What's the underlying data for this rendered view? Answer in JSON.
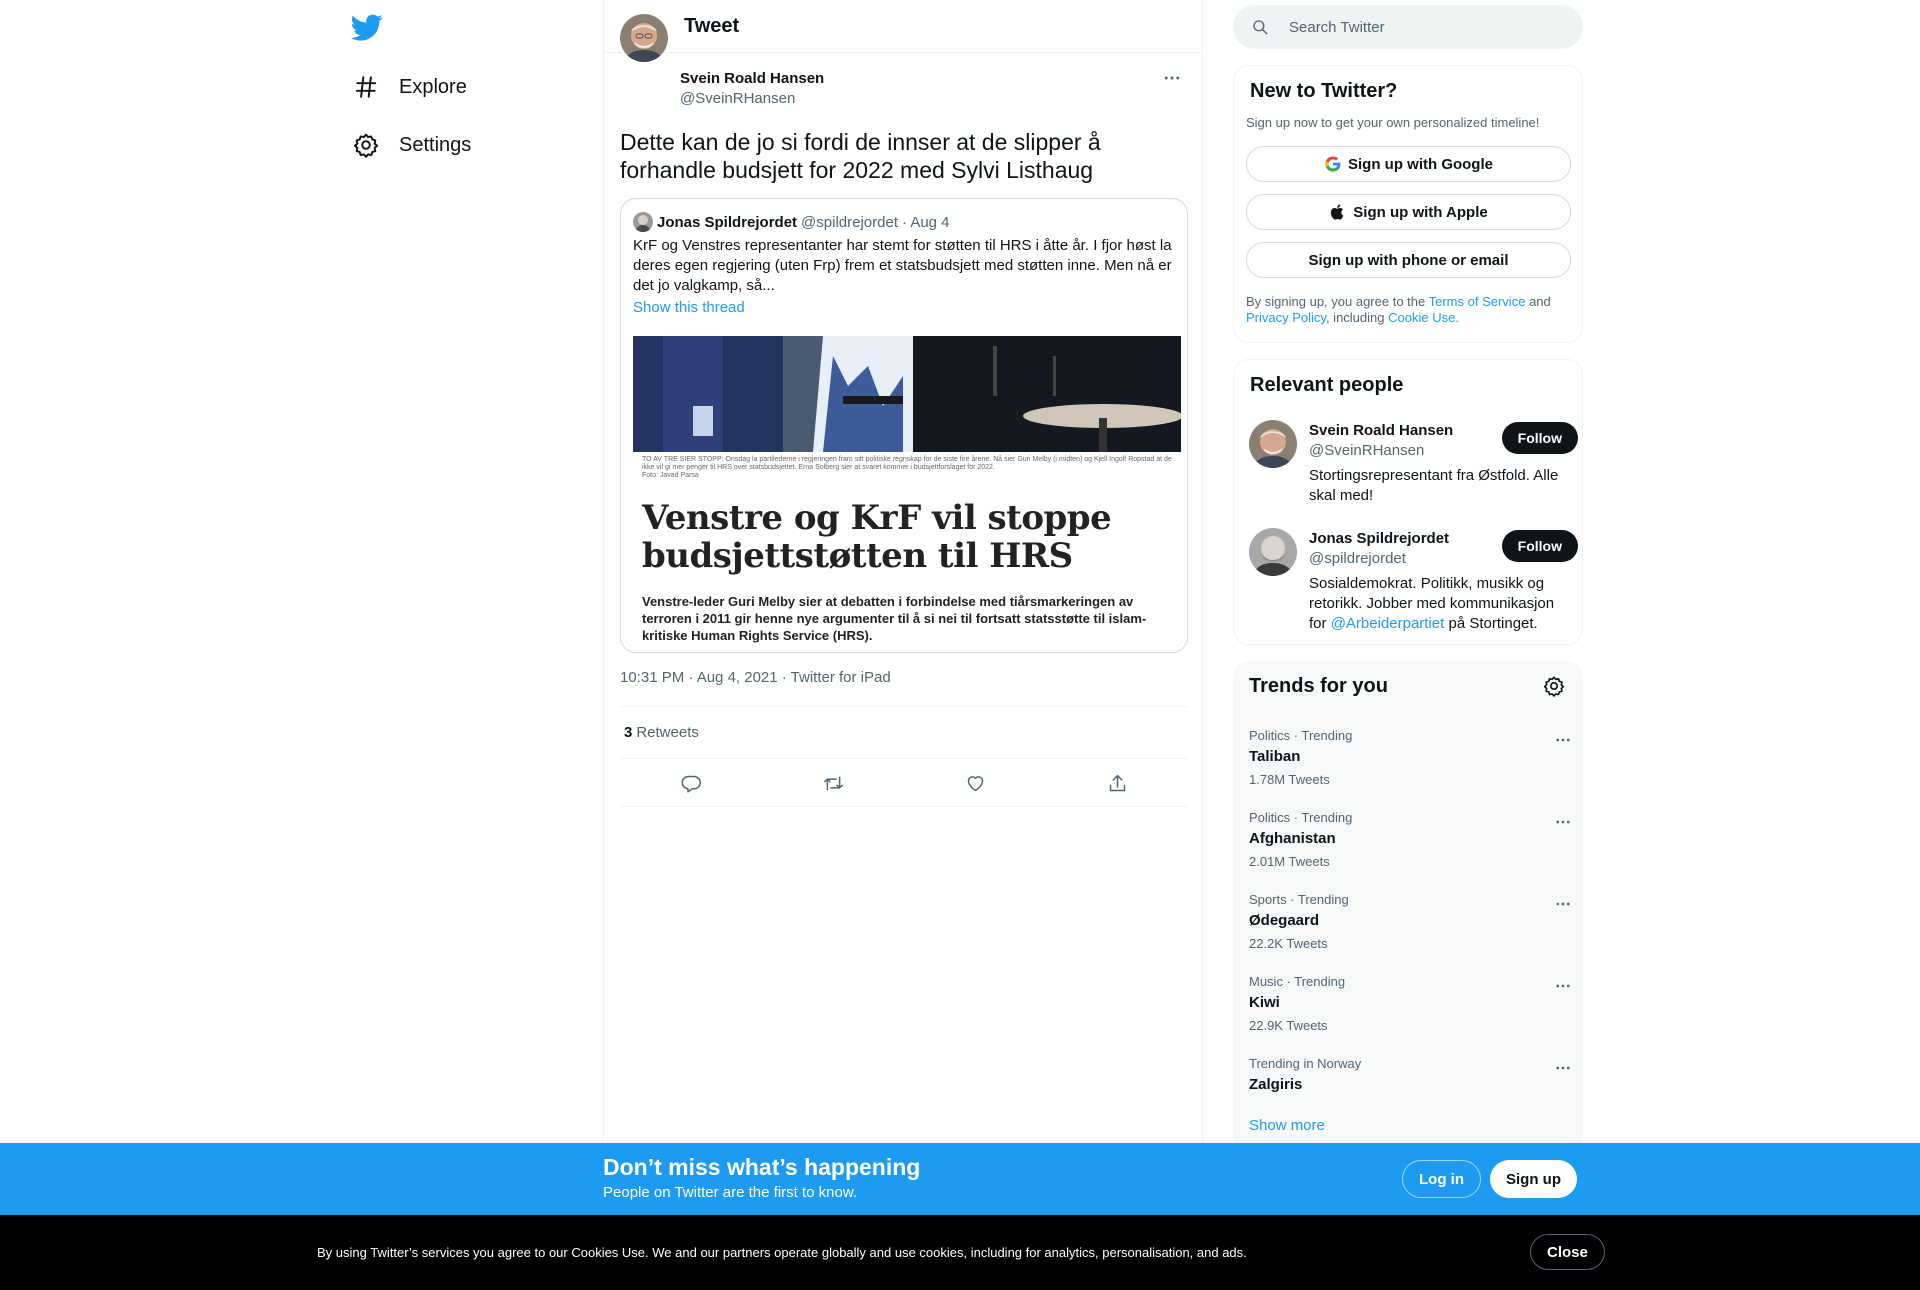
{
  "nav": {
    "items": [
      {
        "label": "Explore",
        "icon": "hashtag-icon"
      },
      {
        "label": "Settings",
        "icon": "gear-icon"
      }
    ]
  },
  "header": {
    "title": "Tweet"
  },
  "tweet": {
    "author_name": "Svein Roald Hansen",
    "author_handle": "@SveinRHansen",
    "text": "Dette kan de jo si fordi de innser at de slipper å forhandle budsjett for 2022 med Sylvi Listhaug",
    "timestamp": "10:31 PM · Aug 4, 2021 · Twitter for iPad",
    "retweets_count": "3",
    "retweets_label": "Retweets",
    "quote": {
      "author_name": "Jonas Spildrejordet",
      "author_handle": "@spildrejordet",
      "date": "· Aug 4",
      "text": "KrF og Venstres representanter har stemt for støtten til HRS i åtte år. I fjor høst la deres egen regjering (uten Frp) frem et statsbudsjett med støtten inne. Men nå er det jo valgkamp, så...",
      "show_thread": "Show this thread",
      "image": {
        "caption": "TO AV TRE SIER STOPP: Onsdag la partilederne i regjeringen fram sitt politiske regnskap for de siste fire årene. Nå sier Guri Melby (i midten) og Kjell Ingolf Ropstad at de ikke vil gi mer penger til HRS over statsbudsjettet. Erna Solberg sier at svaret kommer i budsjettforslaget for 2022.",
        "photo_credit": "Foto: Javad Parsa",
        "headline": "Venstre og KrF vil stoppe budsjettstøtten til HRS",
        "lede": "Venstre-leder Guri Melby sier at debatten i forbindelse med tiårsmarkeringen av terroren i 2011 gir henne nye argumenter til å si nei til fortsatt statsstøtte til islam-kritiske Human Rights Service (HRS)."
      }
    }
  },
  "search": {
    "placeholder": "Search Twitter"
  },
  "signup": {
    "title": "New to Twitter?",
    "subtitle": "Sign up now to get your own personalized timeline!",
    "google": "Sign up with Google",
    "apple": "Sign up with Apple",
    "phone": "Sign up with phone or email",
    "legal_prefix": "By signing up, you agree to the",
    "terms": "Terms of Service",
    "and": "and",
    "privacy": "Privacy Policy",
    "including": ", including",
    "cookie": "Cookie Use."
  },
  "people": {
    "title": "Relevant people",
    "items": [
      {
        "name": "Svein Roald Hansen",
        "handle": "@SveinRHansen",
        "bio": "Stortingsrepresentant fra Østfold. Alle skal med!",
        "follow": "Follow"
      },
      {
        "name": "Jonas Spildrejordet",
        "handle": "@spildrejordet",
        "bio_prefix": "Sosialdemokrat. Politikk, musikk og retorikk. Jobber med kommunikasjon for",
        "bio_link": "@Arbeiderpartiet",
        "bio_suffix": "på Stortinget.",
        "follow": "Follow"
      }
    ]
  },
  "trends": {
    "title": "Trends for you",
    "items": [
      {
        "context": "Politics · Trending",
        "name": "Taliban",
        "count": "1.78M Tweets"
      },
      {
        "context": "Politics · Trending",
        "name": "Afghanistan",
        "count": "2.01M Tweets"
      },
      {
        "context": "Sports · Trending",
        "name": "Ødegaard",
        "count": "22.2K Tweets"
      },
      {
        "context": "Music · Trending",
        "name": "Kiwi",
        "count": "22.9K Tweets"
      },
      {
        "context": "Trending in Norway",
        "name": "Zalgiris",
        "count": ""
      }
    ],
    "show_more": "Show more"
  },
  "bottom_bar": {
    "title": "Don’t miss what’s happening",
    "subtitle": "People on Twitter are the first to know.",
    "login": "Log in",
    "signup": "Sign up"
  },
  "cookie_bar": {
    "text": "By using Twitter’s services you agree to our Cookies Use. We and our partners operate globally and use cookies, including for analytics, personalisation, and ads.",
    "close": "Close"
  },
  "colors": {
    "accent": "#1d9bf0",
    "text_primary": "#0f1419",
    "text_secondary": "#536471",
    "border": "#eff3f4"
  }
}
